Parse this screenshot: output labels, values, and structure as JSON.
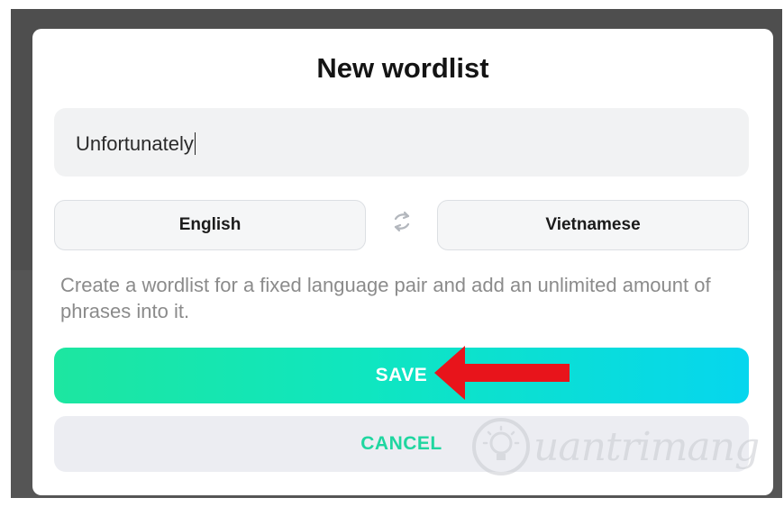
{
  "dialog": {
    "title": "New wordlist",
    "name_input": {
      "value": "Unfortunately",
      "placeholder": ""
    },
    "source_language": "English",
    "target_language": "Vietnamese",
    "swap_icon": "swap-arrows-icon",
    "description": "Create a wordlist for a fixed language pair and add an unlimited amount of phrases into it.",
    "save_label": "SAVE",
    "cancel_label": "CANCEL"
  },
  "annotation": {
    "arrow_color": "#e8141b"
  },
  "watermark": {
    "text": "uantrimang",
    "logo_icon": "lightbulb-icon"
  },
  "colors": {
    "save_gradient_start": "#1de6a0",
    "save_gradient_end": "#06d6ee",
    "cancel_text": "#1fd6a0",
    "backdrop": "#4e4e4e"
  }
}
